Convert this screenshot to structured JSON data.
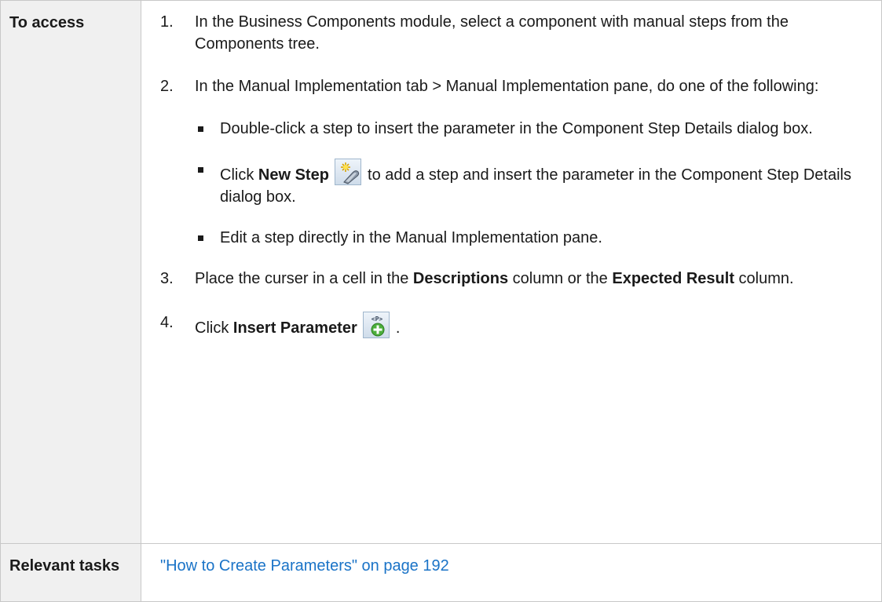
{
  "rows": {
    "access": {
      "label": "To access",
      "steps": [
        {
          "num": "1.",
          "text": "In the Business Components module, select a component with manual steps from the Components tree."
        },
        {
          "num": "2.",
          "text": "In the Manual Implementation tab > Manual Implementation pane, do one of the following:"
        },
        {
          "num": "3.",
          "pre": "Place the curser in a cell in the ",
          "bold1": "Descriptions",
          "mid": " column or the ",
          "bold2": "Expected Result",
          "post": " column."
        },
        {
          "num": "4.",
          "pre": "Click ",
          "bold": "Insert Parameter",
          "post": " ."
        }
      ],
      "substeps": [
        {
          "text": "Double-click a step to insert the parameter in the Component Step Details dialog box."
        },
        {
          "pre": "Click ",
          "bold": "New Step",
          "post": " to add a step and insert the parameter in the Component Step Details dialog box."
        },
        {
          "text": "Edit a step directly in the Manual Implementation pane."
        }
      ],
      "icons": {
        "new_step": "new-step-icon",
        "insert_parameter": "insert-parameter-icon"
      }
    },
    "tasks": {
      "label": "Relevant tasks",
      "link": "\"How to Create Parameters\" on page 192"
    }
  },
  "colors": {
    "label_bg": "#f0f0f0",
    "border": "#c8c8c8",
    "link": "#1a73c7"
  }
}
